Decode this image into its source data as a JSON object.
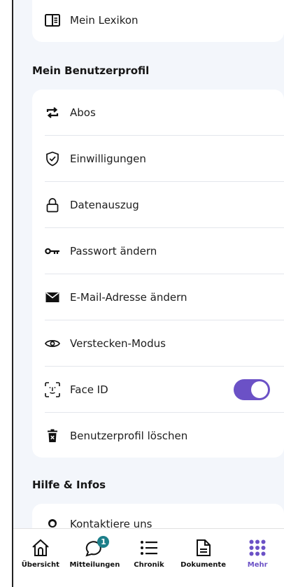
{
  "lexikon": {
    "label": "Mein Lexikon"
  },
  "profile": {
    "title": "Mein Benutzerprofil",
    "items": [
      {
        "label": "Abos",
        "icon": "repeat-icon"
      },
      {
        "label": "Einwilligungen",
        "icon": "shield-check-icon"
      },
      {
        "label": "Datenauszug",
        "icon": "lock-icon"
      },
      {
        "label": "Passwort ändern",
        "icon": "key-icon"
      },
      {
        "label": "E-Mail-Adresse ändern",
        "icon": "envelope-icon"
      },
      {
        "label": "Verstecken-Modus",
        "icon": "eye-icon"
      },
      {
        "label": "Face ID",
        "icon": "face-id-icon",
        "toggle_on": true
      },
      {
        "label": "Benutzerprofil löschen",
        "icon": "trash-icon"
      }
    ]
  },
  "help": {
    "title": "Hilfe & Infos",
    "items": [
      {
        "label": "Kontaktiere uns",
        "icon": "person-icon"
      }
    ]
  },
  "tabbar": {
    "items": [
      {
        "label": "Übersicht",
        "icon": "home-icon"
      },
      {
        "label": "Mitteilungen",
        "icon": "chat-icon",
        "badge": "1"
      },
      {
        "label": "Chronik",
        "icon": "list-icon"
      },
      {
        "label": "Dokumente",
        "icon": "document-icon"
      },
      {
        "label": "Mehr",
        "icon": "grid-dots-icon",
        "active": true
      }
    ]
  },
  "colors": {
    "accent": "#6b51c6",
    "badge": "#1d7f8a",
    "background": "#f3f6fb"
  }
}
